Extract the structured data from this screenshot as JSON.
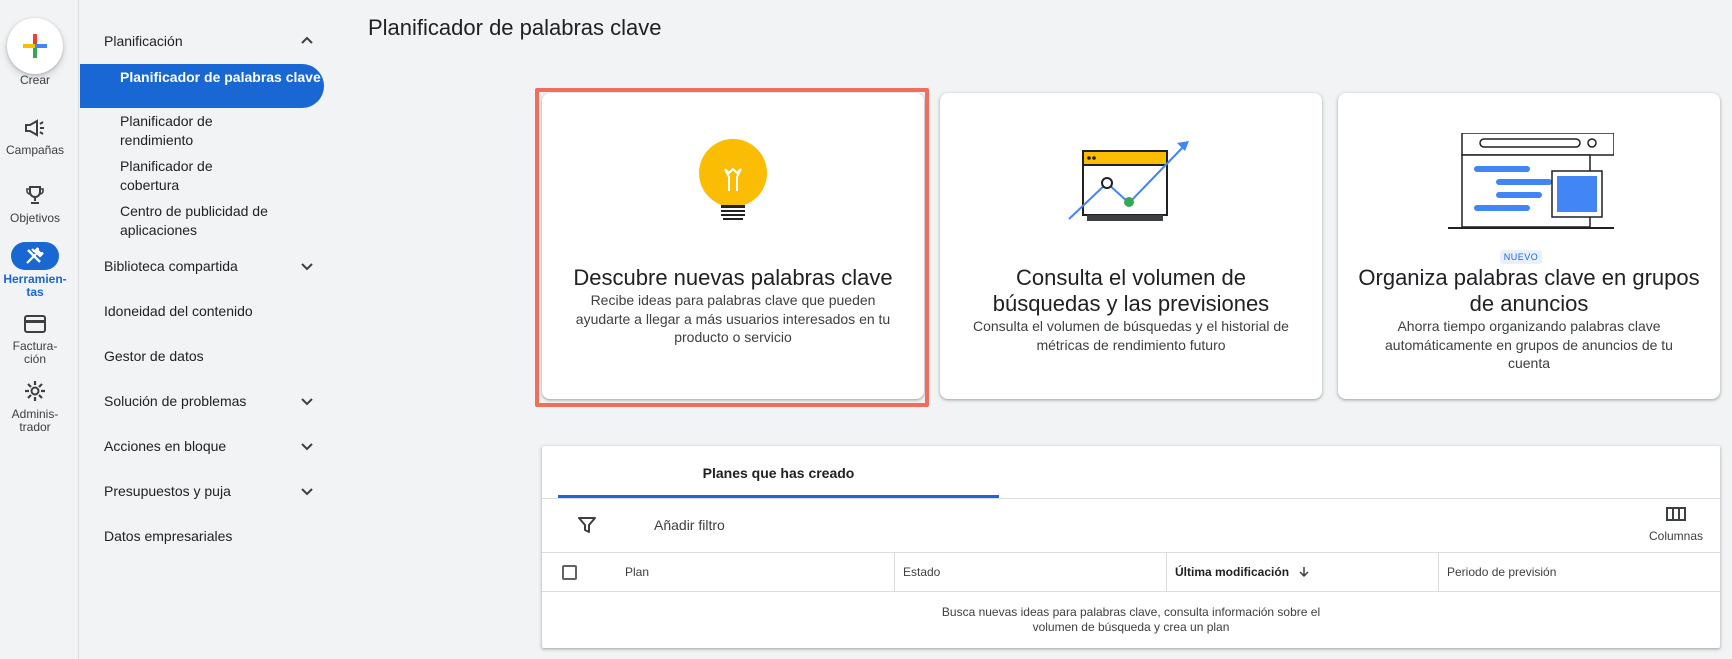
{
  "rail": {
    "create_label": "Crear",
    "items": [
      {
        "label": "Campañas",
        "icon": "megaphone-icon"
      },
      {
        "label": "Objetivos",
        "icon": "trophy-icon"
      },
      {
        "label": "Herramien-\ntas",
        "icon": "tools-icon",
        "active": true
      },
      {
        "label": "Factura-\nción",
        "icon": "credit-card-icon"
      },
      {
        "label": "Adminis-\ntrador",
        "icon": "gear-icon"
      }
    ]
  },
  "sidebar": {
    "planning": {
      "label": "Planificación",
      "children": [
        {
          "label": "Planificador de palabras clave",
          "active": true
        },
        {
          "label": "Planificador de rendimiento"
        },
        {
          "label": "Planificador de cobertura"
        },
        {
          "label": "Centro de publicidad de aplicaciones"
        }
      ]
    },
    "items": [
      {
        "label": "Biblioteca compartida",
        "expandable": true
      },
      {
        "label": "Idoneidad del contenido",
        "expandable": false
      },
      {
        "label": "Gestor de datos",
        "expandable": false
      },
      {
        "label": "Solución de problemas",
        "expandable": true
      },
      {
        "label": "Acciones en bloque",
        "expandable": true
      },
      {
        "label": "Presupuestos y puja",
        "expandable": true
      },
      {
        "label": "Datos empresariales",
        "expandable": false
      }
    ]
  },
  "page_title": "Planificador de palabras clave",
  "cards": [
    {
      "title": "Descubre nuevas palabras clave",
      "description": "Recibe ideas para palabras clave que pueden ayudarte a llegar a más usuarios interesados en tu producto o servicio",
      "icon": "lightbulb-illustration"
    },
    {
      "title": "Consulta el volumen de búsquedas y las previsiones",
      "description": "Consulta el volumen de búsquedas y el historial de métricas de rendimiento futuro",
      "icon": "chart-illustration"
    },
    {
      "title": "Organiza palabras clave en grupos de anuncios",
      "description": "Ahorra tiempo organizando palabras clave automáticamente en grupos de anuncios de tu cuenta",
      "badge": "NUEVO",
      "icon": "ad-groups-illustration"
    }
  ],
  "plans": {
    "tab_label": "Planes que has creado",
    "filter_label": "Añadir filtro",
    "columns_label": "Columnas",
    "headers": [
      "Plan",
      "Estado",
      "Última modificación",
      "Periodo de previsión"
    ],
    "empty_message": "Busca nuevas ideas para palabras clave, consulta información sobre el volumen de búsqueda y crea un plan"
  },
  "colors": {
    "accent": "#1967d2",
    "highlight": "#f26d5b",
    "bulb": "#fbbc04"
  }
}
